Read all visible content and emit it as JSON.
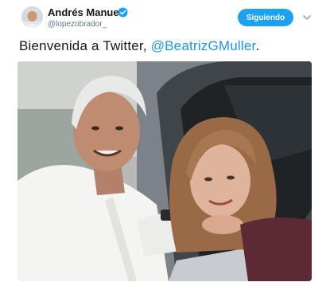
{
  "tweet": {
    "author_name": "Andrés Manuel",
    "handle": "@lopezobrador_",
    "follow_label": "Siguiendo",
    "text_prefix": "Bienvenida a Twitter, ",
    "mention": "@BeatrizGMuller",
    "text_suffix": "."
  },
  "icons": {
    "verified": "verified-badge-icon",
    "caret": "chevron-down-icon"
  },
  "colors": {
    "accent": "#1da1f2",
    "mention": "#1b95e0",
    "text": "#14171a",
    "muted": "#657786"
  }
}
